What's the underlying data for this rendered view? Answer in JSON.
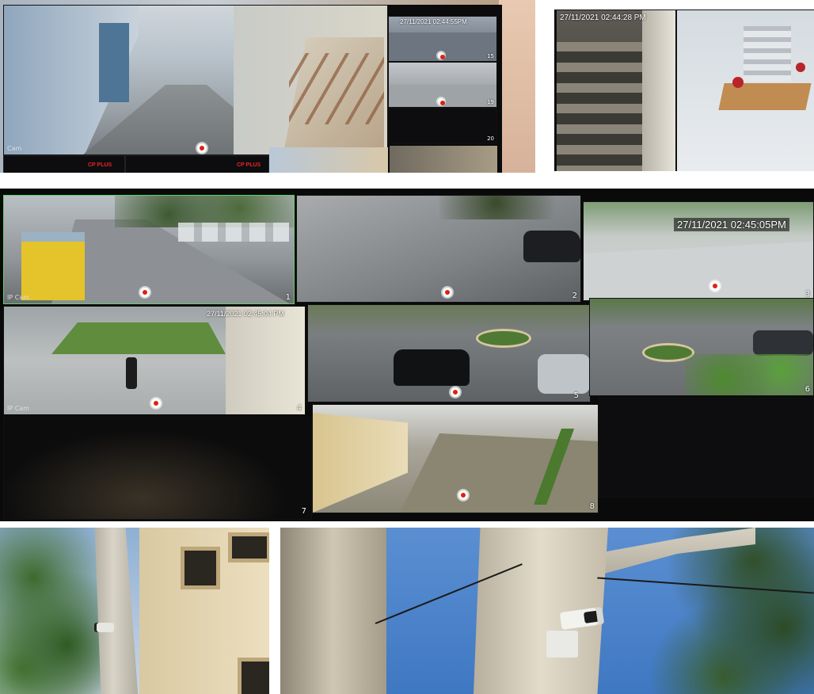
{
  "panel_top_left": {
    "brand_label": "CP PLUS",
    "cam_label": "Cam",
    "feeds": [
      {
        "timestamp": "27/11/2021 02:44:55PM",
        "number": "15"
      },
      {
        "timestamp": "",
        "number": "19"
      },
      {
        "timestamp": "",
        "number": "20"
      }
    ]
  },
  "panel_top_right": {
    "timestamp": "27/11/2021 02:44:28 PM"
  },
  "panel_middle": {
    "cam_label": "IP Cam",
    "top_right_timestamp": "27/11/2021 02:45:05PM",
    "row2_timestamp": "27/11/2021 02:45:04 PM",
    "feeds": [
      {
        "number": "1"
      },
      {
        "number": "2"
      },
      {
        "number": "3"
      },
      {
        "number": "4"
      },
      {
        "number": "5"
      },
      {
        "number": "6"
      },
      {
        "number": "7"
      },
      {
        "number": "8"
      }
    ]
  },
  "colors": {
    "sky": "#5f8fd0",
    "bark": "#c9c3b5",
    "foliage": "#3d5a2c",
    "asphalt": "#6a6d72",
    "monitor_black": "#0d0d0f",
    "wall_cream": "#e4d8b8"
  }
}
